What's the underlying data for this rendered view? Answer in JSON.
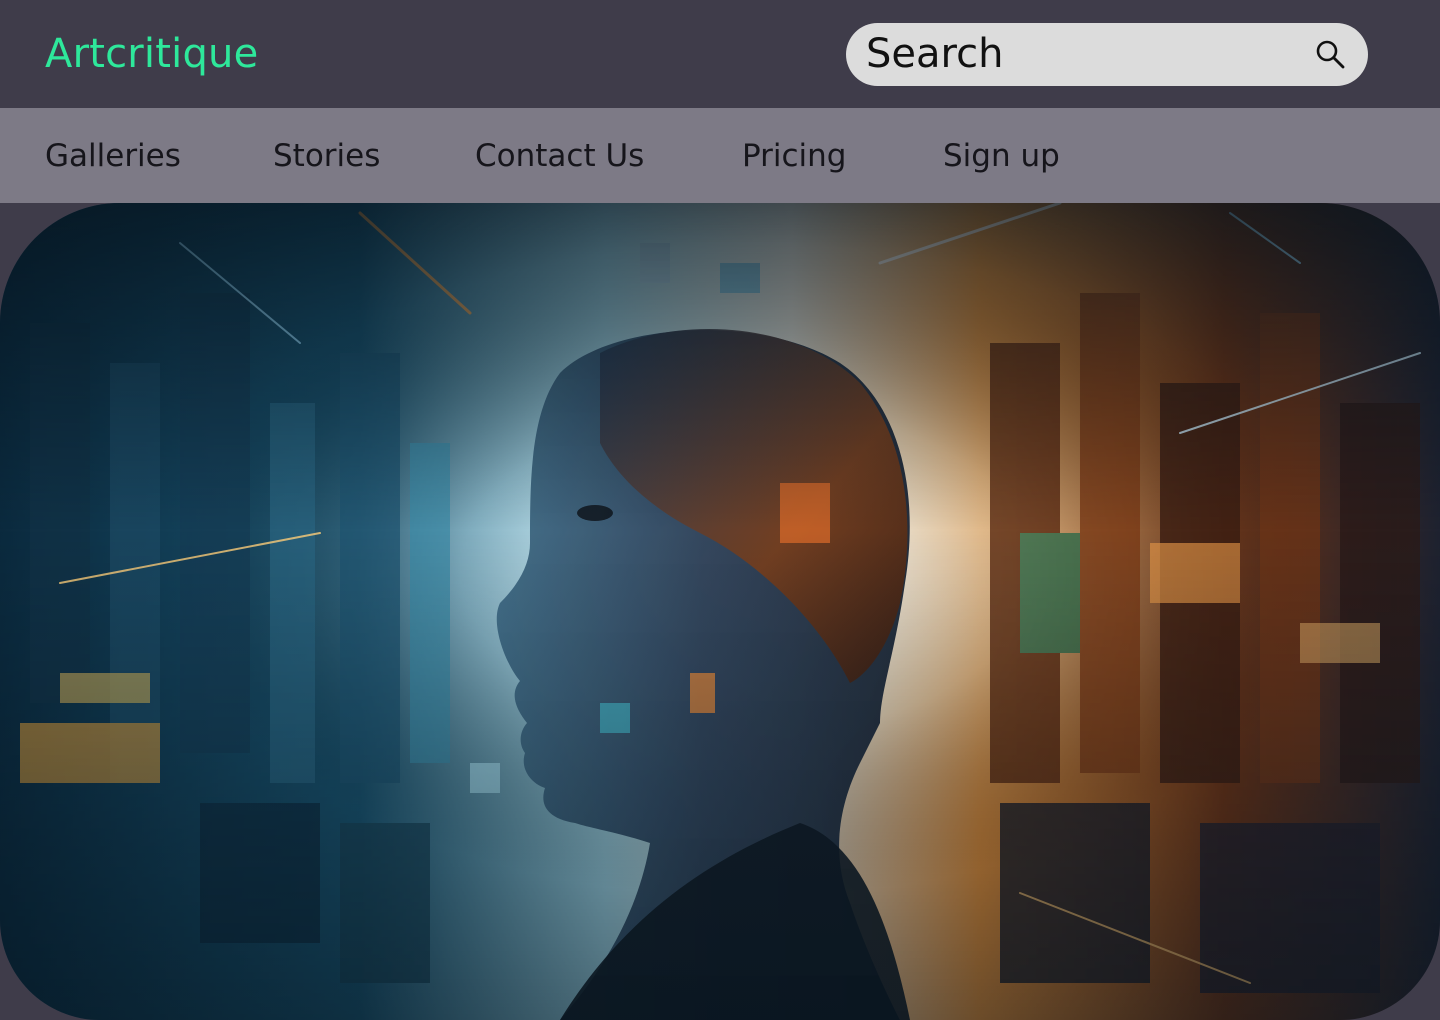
{
  "header": {
    "logo_text": "Artcritique",
    "search": {
      "placeholder": "Search",
      "icon": "search-icon"
    }
  },
  "nav": {
    "items": [
      {
        "label": "Galleries"
      },
      {
        "label": "Stories"
      },
      {
        "label": "Contact Us"
      },
      {
        "label": "Pricing"
      },
      {
        "label": "Sign up"
      }
    ]
  },
  "hero": {
    "image": "digital-collage-woman-profile"
  },
  "colors": {
    "accent": "#2ee89b",
    "topbar": "#3f3c4a",
    "navbar": "#7d7a86",
    "search_bg": "#dcdcdc"
  }
}
